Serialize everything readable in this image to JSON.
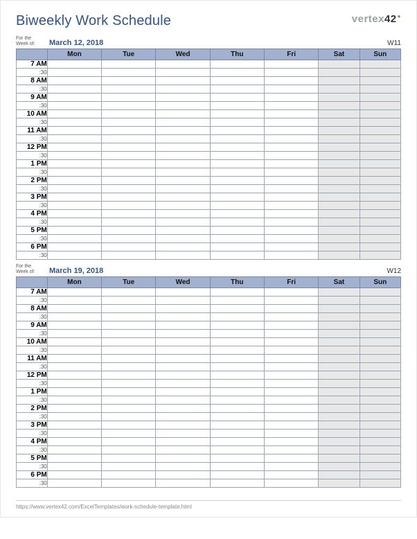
{
  "title": "Biweekly Work Schedule",
  "brand": {
    "name": "vertex",
    "num": "42"
  },
  "for_week_label": "For the\nWeek of:",
  "half_hour_label": ":30",
  "days": [
    "Mon",
    "Tue",
    "Wed",
    "Thu",
    "Fri",
    "Sat",
    "Sun"
  ],
  "hours": [
    "7 AM",
    "8 AM",
    "9 AM",
    "10 AM",
    "11 AM",
    "12 PM",
    "1 PM",
    "2 PM",
    "3 PM",
    "4 PM",
    "5 PM",
    "6 PM"
  ],
  "weeks": [
    {
      "date": "March 12, 2018",
      "weeknum": "W11"
    },
    {
      "date": "March 19, 2018",
      "weeknum": "W12"
    }
  ],
  "footer_url": "https://www.vertex42.com/ExcelTemplates/work-schedule-template.html"
}
